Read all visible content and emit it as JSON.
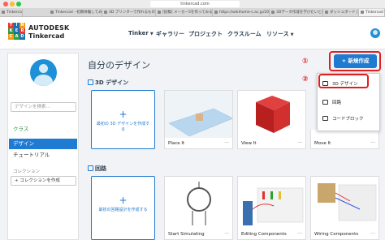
{
  "browser": {
    "url": "tinkercad.com",
    "tabs": [
      "Tinkercad",
      "Tinkercad - 初期体験してみよう",
      "3D プリンターで作れるものは？",
      "[投稿] メーカー5を作ってみる",
      "3D デザインと3Dモデル作成を中…",
      "https://wikihome-s.ac.jp/20…",
      "3Dデータ作成を学びたいと思う子ど…",
      "ダッシュボード | Tinkercad",
      "Tinkercad"
    ]
  },
  "header": {
    "logo_letters": [
      "T",
      "I",
      "N",
      "K",
      "E",
      "R",
      "C",
      "A",
      "D"
    ],
    "brand_top": "AUTODESK",
    "brand_bottom": "Tinkercad",
    "nav": [
      "Tinker",
      "ギャラリー",
      "プロジェクト",
      "クラスルーム",
      "リソース"
    ]
  },
  "sidebar": {
    "search_placeholder": "デザインを検索...",
    "class_label": "クラス",
    "items": [
      "デザイン",
      "チュートリアル"
    ],
    "collections_label": "コレクション",
    "collection_button": "+ コレクションを作成"
  },
  "main": {
    "title": "自分のデザイン",
    "new_button": "+ 新規作成",
    "section_3d": "3D デザイン",
    "create_3d": "最初の 3D デザインを作成する",
    "section_circuits": "回路",
    "create_circuit": "最初の回路設計を作成する",
    "cards_3d": [
      "Place It",
      "View It",
      "Move It"
    ],
    "cards_circuits": [
      "Start Simulating",
      "Editing Components",
      "Wiring Components"
    ],
    "card_more": "···"
  },
  "dropdown": {
    "items": [
      "3D デザイン",
      "回路",
      "コードブロック"
    ]
  },
  "callouts": [
    "①",
    "②"
  ],
  "colors": {
    "accent": "#1f7ad1",
    "callout_red": "#e02020"
  }
}
